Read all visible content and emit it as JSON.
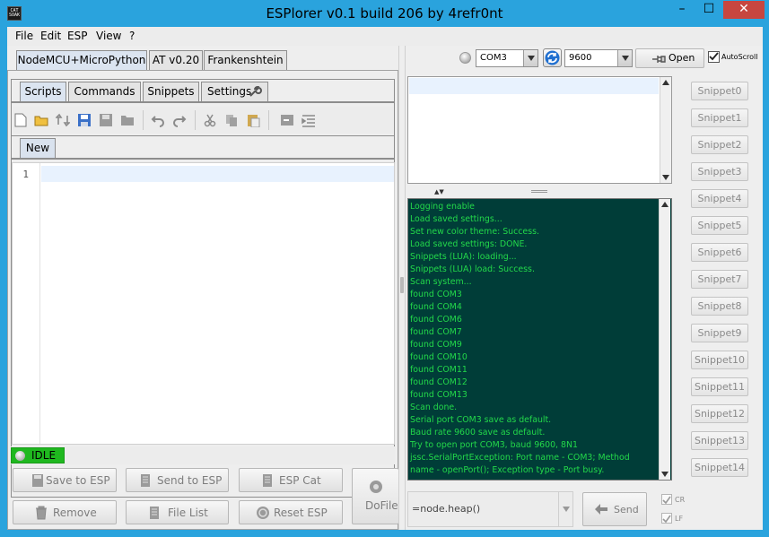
{
  "window": {
    "title": "ESPlorer v0.1 build 206 by 4refr0nt",
    "icon_text": "CAT SOAK",
    "minimize_glyph": "–",
    "maximize_glyph": "☐",
    "close_glyph": "✕"
  },
  "menubar": {
    "items": [
      "File",
      "Edit",
      "ESP",
      "View",
      "?"
    ]
  },
  "firmware_tabs": [
    "NodeMCU+MicroPython",
    "AT v0.20",
    "Frankenshtein"
  ],
  "editor_tabs": [
    "Scripts",
    "Commands",
    "Snippets",
    "Settings"
  ],
  "file_tabs": [
    "New"
  ],
  "editor": {
    "line_numbers": [
      "1"
    ],
    "content": ""
  },
  "status": {
    "text": "IDLE",
    "color": "#1fb81f"
  },
  "left_buttons": {
    "save_to_esp": "Save to ESP",
    "send_to_esp": "Send to ESP",
    "esp_cat": "ESP Cat",
    "remove": "Remove",
    "file_list": "File List",
    "reset_esp": "Reset ESP",
    "do_file": "DoFile"
  },
  "connection": {
    "port": "COM3",
    "baud": "9600",
    "open_label": "Open",
    "autoscroll_label": "AutoScroll",
    "autoscroll_checked": true
  },
  "log": {
    "background": "#003d38",
    "text_color": "#22d84a",
    "lines": [
      "Logging enable",
      "Load saved settings...",
      "Set new color theme: Success.",
      "Load saved settings: DONE.",
      "Snippets (LUA): loading...",
      "Snippets (LUA) load: Success.",
      "Scan system...",
      "found COM3",
      "found COM4",
      "found COM6",
      "found COM7",
      "found COM9",
      "found COM10",
      "found COM11",
      "found COM12",
      "found COM13",
      "Scan done.",
      "Serial port COM3 save as default.",
      "Baud rate 9600 save as default.",
      "Try to open port COM3, baud 9600, 8N1",
      "jssc.SerialPortException: Port name - COM3; Method",
      "name - openPort(); Exception type - Port busy."
    ]
  },
  "command": {
    "value": "=node.heap()",
    "send_label": "Send",
    "cr_label": "CR",
    "lf_label": "LF",
    "cr_checked": true,
    "lf_checked": true
  },
  "snippets": [
    "Snippet0",
    "Snippet1",
    "Snippet2",
    "Snippet3",
    "Snippet4",
    "Snippet5",
    "Snippet6",
    "Snippet7",
    "Snippet8",
    "Snippet9",
    "Snippet10",
    "Snippet11",
    "Snippet12",
    "Snippet13",
    "Snippet14"
  ]
}
